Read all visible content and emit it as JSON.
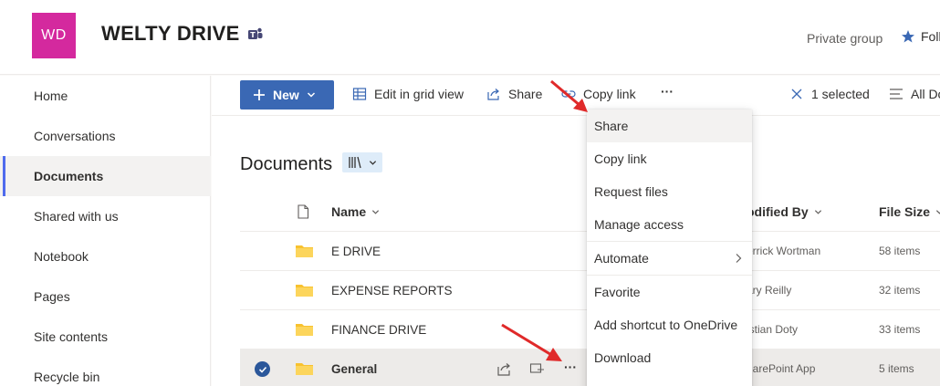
{
  "header": {
    "logo_initials": "WD",
    "site_title": "WELTY DRIVE",
    "privacy": "Private group",
    "follow_label": "Foll"
  },
  "leftnav": {
    "items": [
      {
        "label": "Home"
      },
      {
        "label": "Conversations"
      },
      {
        "label": "Documents",
        "active": true
      },
      {
        "label": "Shared with us"
      },
      {
        "label": "Notebook"
      },
      {
        "label": "Pages"
      },
      {
        "label": "Site contents"
      },
      {
        "label": "Recycle bin"
      }
    ]
  },
  "commandbar": {
    "new_label": "New",
    "edit_grid": "Edit in grid view",
    "share": "Share",
    "copy_link": "Copy link",
    "more": "···",
    "selected": "1 selected",
    "all_docs": "All Do"
  },
  "library": {
    "title": "Documents"
  },
  "table": {
    "columns": {
      "name": "Name",
      "modified_by": "odified By",
      "file_size": "File Size"
    },
    "rows": [
      {
        "name": "E DRIVE",
        "modified_by": "errick Wortman",
        "size": "58 items"
      },
      {
        "name": "EXPENSE REPORTS",
        "modified_by": "ary Reilly",
        "size": "32 items"
      },
      {
        "name": "FINANCE DRIVE",
        "modified_by": "istian Doty",
        "size": "33 items"
      },
      {
        "name": "General",
        "modified_by": "narePoint App",
        "size": "5 items",
        "selected": true
      }
    ],
    "row_more": "···"
  },
  "context_menu": {
    "items": [
      {
        "label": "Share"
      },
      {
        "label": "Copy link"
      },
      {
        "label": "Request files"
      },
      {
        "label": "Manage access"
      },
      {
        "label": "Automate"
      },
      {
        "label": "Favorite"
      },
      {
        "label": "Add shortcut to OneDrive"
      },
      {
        "label": "Download"
      }
    ]
  },
  "colors": {
    "accent": "#3a68b4",
    "logo": "#d4299e",
    "annotation_arrow": "#e02a2a",
    "folder": "#f8c22f"
  }
}
